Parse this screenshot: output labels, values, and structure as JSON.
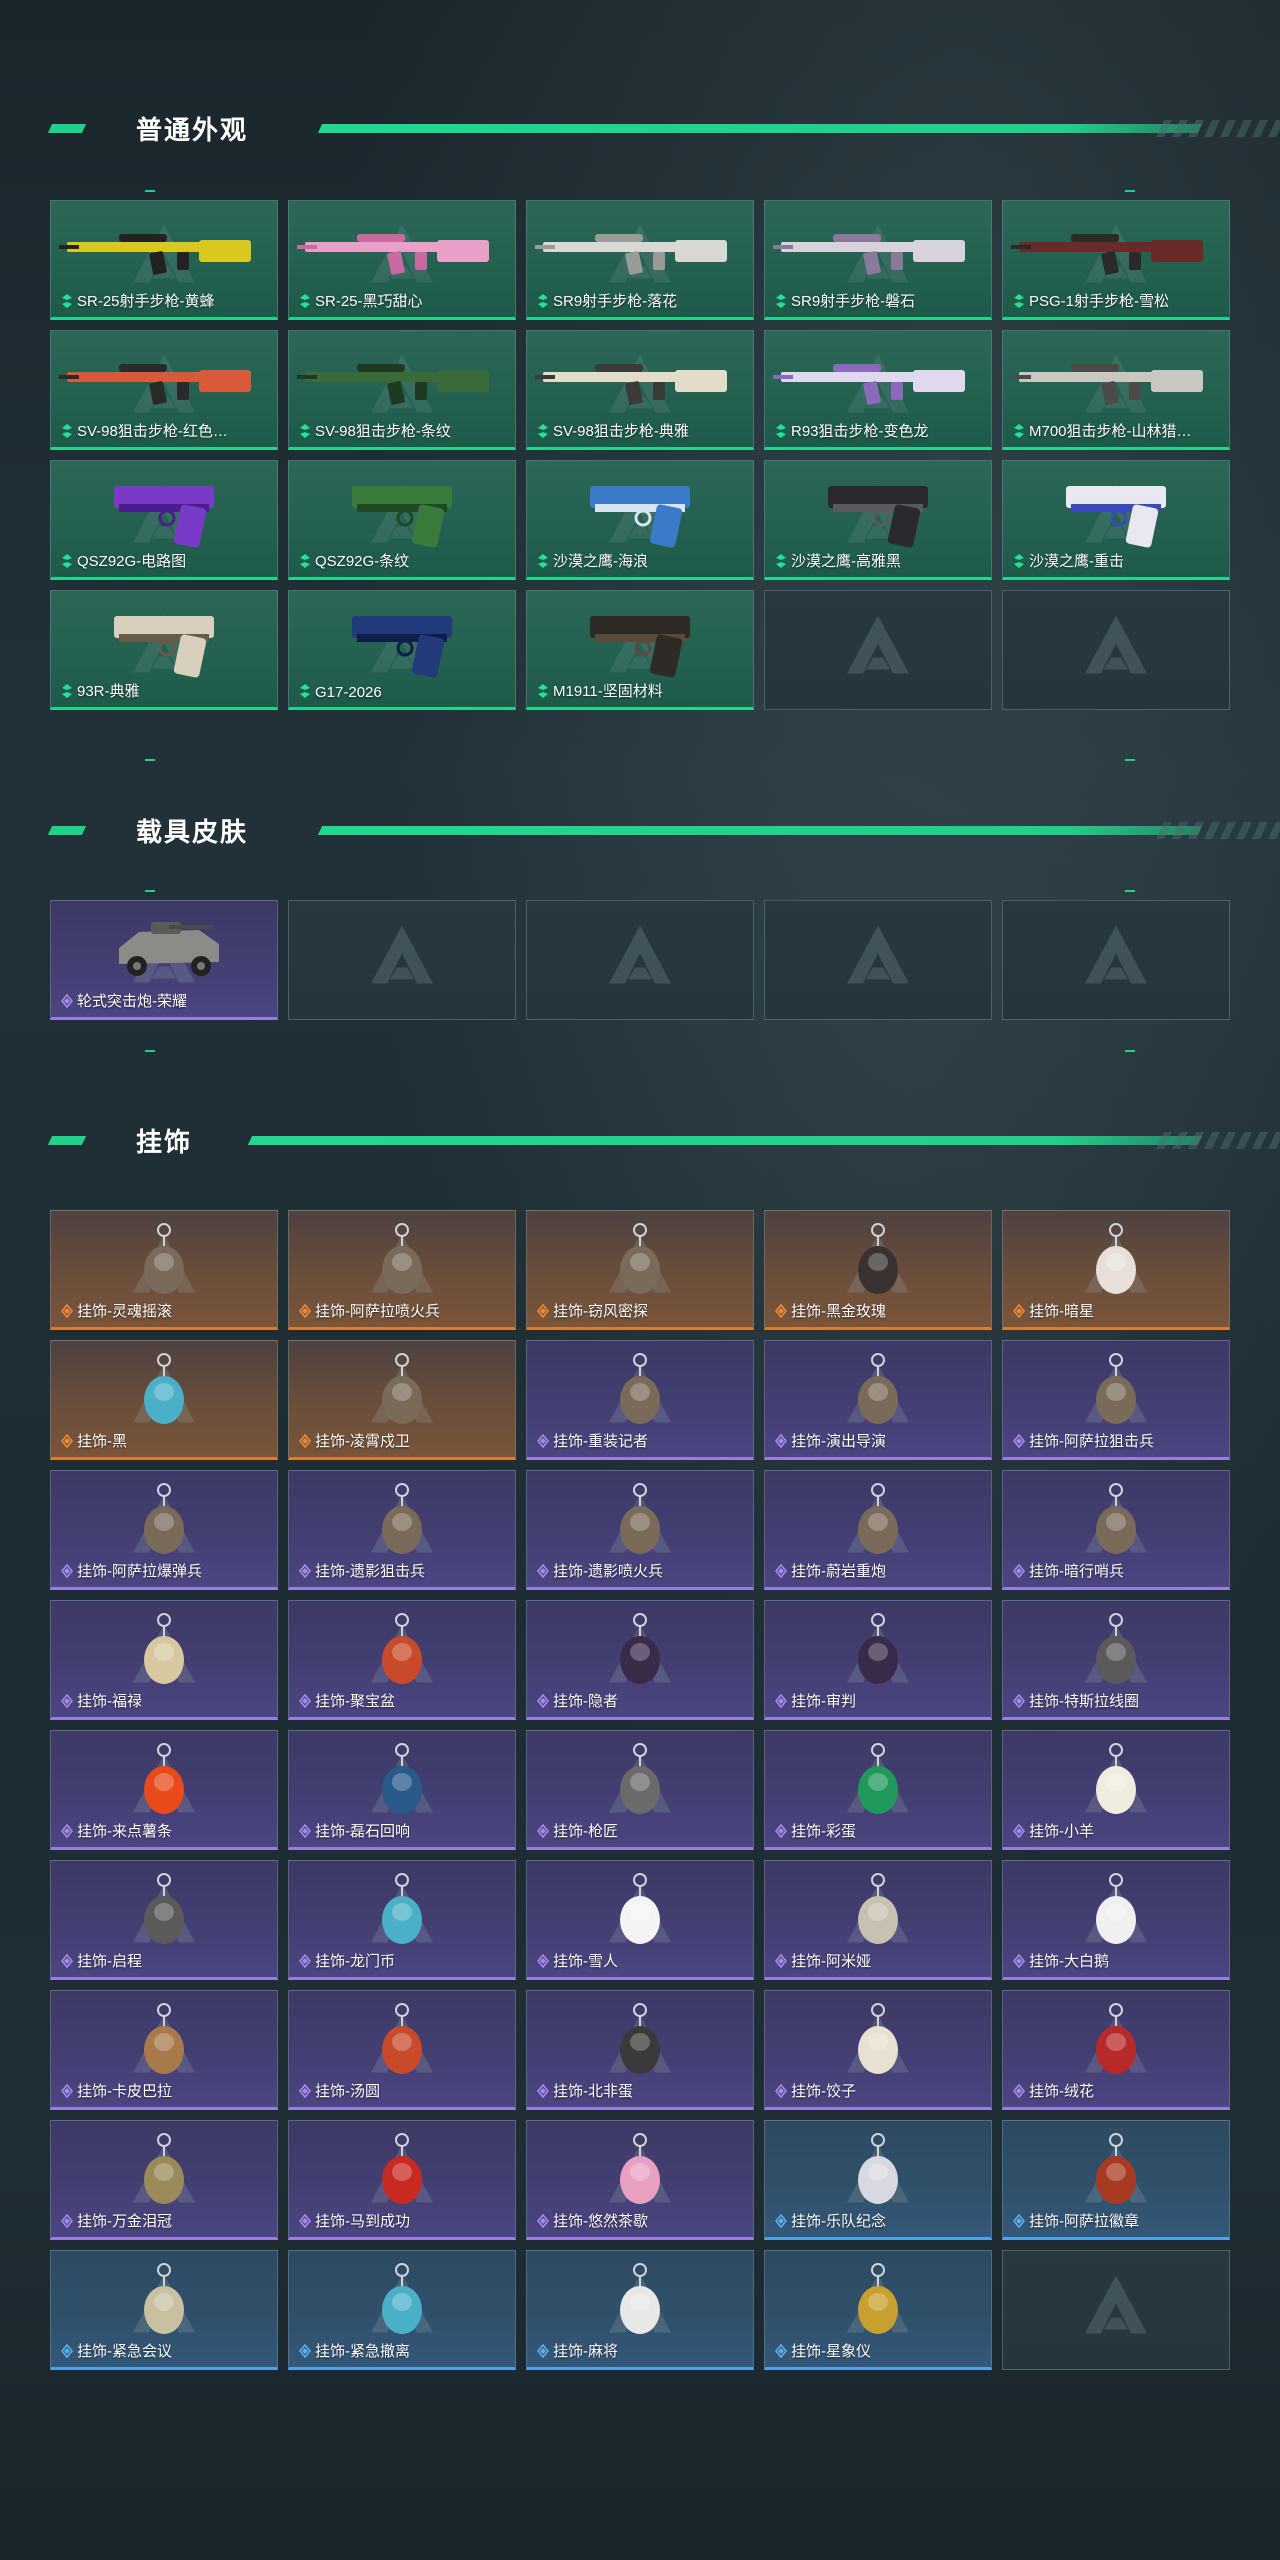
{
  "sections": [
    {
      "title": "普通外观",
      "items": [
        {
          "label": "SR-25射手步枪-黄蜂",
          "rarity": "green",
          "icon": "rifle-yellow-black-icon"
        },
        {
          "label": "SR-25-黑巧甜心",
          "rarity": "green",
          "icon": "rifle-pink-icon"
        },
        {
          "label": "SR9射手步枪-落花",
          "rarity": "green",
          "icon": "rifle-white-icon"
        },
        {
          "label": "SR9射手步枪-磐石",
          "rarity": "green",
          "icon": "rifle-marble-icon"
        },
        {
          "label": "PSG-1射手步枪-雪松",
          "rarity": "green",
          "icon": "rifle-dark-red-icon"
        },
        {
          "label": "SV-98狙击步枪-红色…",
          "rarity": "green",
          "icon": "sniper-red-icon"
        },
        {
          "label": "SV-98狙击步枪-条纹",
          "rarity": "green",
          "icon": "sniper-camo-icon"
        },
        {
          "label": "SV-98狙击步枪-典雅",
          "rarity": "green",
          "icon": "sniper-cream-icon"
        },
        {
          "label": "R93狙击步枪-变色龙",
          "rarity": "green",
          "icon": "sniper-purple-icon"
        },
        {
          "label": "M700狙击步枪-山林猎…",
          "rarity": "green",
          "icon": "sniper-grey-icon"
        },
        {
          "label": "QSZ92G-电路图",
          "rarity": "green",
          "icon": "pistol-purple-icon"
        },
        {
          "label": "QSZ92G-条纹",
          "rarity": "green",
          "icon": "pistol-green-icon"
        },
        {
          "label": "沙漠之鹰-海浪",
          "rarity": "green",
          "icon": "deagle-blue-icon"
        },
        {
          "label": "沙漠之鹰-高雅黑",
          "rarity": "green",
          "icon": "deagle-black-icon"
        },
        {
          "label": "沙漠之鹰-重击",
          "rarity": "green",
          "icon": "deagle-white-icon"
        },
        {
          "label": "93R-典雅",
          "rarity": "green",
          "icon": "pistol-cream-icon"
        },
        {
          "label": "G17-2026",
          "rarity": "green",
          "icon": "pistol-navy-icon"
        },
        {
          "label": "M1911-坚固材料",
          "rarity": "green",
          "icon": "pistol-dark-icon"
        },
        {
          "label": "",
          "rarity": "empty",
          "icon": "empty-slot-icon"
        },
        {
          "label": "",
          "rarity": "empty",
          "icon": "empty-slot-icon"
        }
      ]
    },
    {
      "title": "载具皮肤",
      "items": [
        {
          "label": "轮式突击炮-荣耀",
          "rarity": "purple",
          "icon": "vehicle-icon"
        },
        {
          "label": "",
          "rarity": "empty",
          "icon": "empty-slot-icon"
        },
        {
          "label": "",
          "rarity": "empty",
          "icon": "empty-slot-icon"
        },
        {
          "label": "",
          "rarity": "empty",
          "icon": "empty-slot-icon"
        },
        {
          "label": "",
          "rarity": "empty",
          "icon": "empty-slot-icon"
        }
      ]
    },
    {
      "title": "挂饰",
      "items": [
        {
          "label": "挂饰-灵魂摇滚",
          "rarity": "orange",
          "icon": "charm-figure-icon"
        },
        {
          "label": "挂饰-阿萨拉喷火兵",
          "rarity": "orange",
          "icon": "charm-figure-icon"
        },
        {
          "label": "挂饰-窃风密探",
          "rarity": "orange",
          "icon": "charm-figure-icon"
        },
        {
          "label": "挂饰-黑金玫瑰",
          "rarity": "orange",
          "icon": "charm-rose-icon"
        },
        {
          "label": "挂饰-暗星",
          "rarity": "orange",
          "icon": "charm-star-icon"
        },
        {
          "label": "挂饰-黑",
          "rarity": "orange",
          "icon": "charm-tag-icon"
        },
        {
          "label": "挂饰-凌霄戍卫",
          "rarity": "orange",
          "icon": "charm-figure-icon"
        },
        {
          "label": "挂饰-重装记者",
          "rarity": "purple",
          "icon": "charm-figure-icon"
        },
        {
          "label": "挂饰-演出导演",
          "rarity": "purple",
          "icon": "charm-figure-icon"
        },
        {
          "label": "挂饰-阿萨拉狙击兵",
          "rarity": "purple",
          "icon": "charm-figure-icon"
        },
        {
          "label": "挂饰-阿萨拉爆弹兵",
          "rarity": "purple",
          "icon": "charm-figure-icon"
        },
        {
          "label": "挂饰-遗影狙击兵",
          "rarity": "purple",
          "icon": "charm-figure-icon"
        },
        {
          "label": "挂饰-遗影喷火兵",
          "rarity": "purple",
          "icon": "charm-figure-icon"
        },
        {
          "label": "挂饰-蔚岩重炮",
          "rarity": "purple",
          "icon": "charm-figure-icon"
        },
        {
          "label": "挂饰-暗行哨兵",
          "rarity": "purple",
          "icon": "charm-figure-icon"
        },
        {
          "label": "挂饰-福禄",
          "rarity": "purple",
          "icon": "charm-gourd-icon"
        },
        {
          "label": "挂饰-聚宝盆",
          "rarity": "purple",
          "icon": "charm-bowl-icon"
        },
        {
          "label": "挂饰-隐者",
          "rarity": "purple",
          "icon": "charm-card-icon"
        },
        {
          "label": "挂饰-审判",
          "rarity": "purple",
          "icon": "charm-card-icon"
        },
        {
          "label": "挂饰-特斯拉线圈",
          "rarity": "purple",
          "icon": "charm-coil-icon"
        },
        {
          "label": "挂饰-来点薯条",
          "rarity": "purple",
          "icon": "charm-fries-icon"
        },
        {
          "label": "挂饰-磊石回响",
          "rarity": "purple",
          "icon": "charm-ring-icon"
        },
        {
          "label": "挂饰-枪匠",
          "rarity": "purple",
          "icon": "charm-box-icon"
        },
        {
          "label": "挂饰-彩蛋",
          "rarity": "purple",
          "icon": "charm-egg-icon"
        },
        {
          "label": "挂饰-小羊",
          "rarity": "purple",
          "icon": "charm-sheep-icon"
        },
        {
          "label": "挂饰-启程",
          "rarity": "purple",
          "icon": "charm-compass-icon"
        },
        {
          "label": "挂饰-龙门币",
          "rarity": "purple",
          "icon": "charm-tag-icon"
        },
        {
          "label": "挂饰-雪人",
          "rarity": "purple",
          "icon": "charm-snowman-icon"
        },
        {
          "label": "挂饰-阿米娅",
          "rarity": "purple",
          "icon": "charm-bunny-icon"
        },
        {
          "label": "挂饰-大白鹅",
          "rarity": "purple",
          "icon": "charm-goose-icon"
        },
        {
          "label": "挂饰-卡皮巴拉",
          "rarity": "purple",
          "icon": "charm-capybara-icon"
        },
        {
          "label": "挂饰-汤圆",
          "rarity": "purple",
          "icon": "charm-bowl-icon"
        },
        {
          "label": "挂饰-北非蛋",
          "rarity": "purple",
          "icon": "charm-pan-icon"
        },
        {
          "label": "挂饰-饺子",
          "rarity": "purple",
          "icon": "charm-plate-icon"
        },
        {
          "label": "挂饰-绒花",
          "rarity": "purple",
          "icon": "charm-flower-icon"
        },
        {
          "label": "挂饰-万金泪冠",
          "rarity": "purple",
          "icon": "charm-burger-icon"
        },
        {
          "label": "挂饰-马到成功",
          "rarity": "purple",
          "icon": "charm-horse-icon"
        },
        {
          "label": "挂饰-悠然茶歇",
          "rarity": "purple",
          "icon": "charm-cake-icon"
        },
        {
          "label": "挂饰-乐队纪念",
          "rarity": "blue",
          "icon": "charm-badge-icon"
        },
        {
          "label": "挂饰-阿萨拉徽章",
          "rarity": "blue",
          "icon": "charm-medal-icon"
        },
        {
          "label": "挂饰-紧急会议",
          "rarity": "blue",
          "icon": "charm-crest-icon"
        },
        {
          "label": "挂饰-紧急撤离",
          "rarity": "blue",
          "icon": "charm-tag-icon"
        },
        {
          "label": "挂饰-麻将",
          "rarity": "blue",
          "icon": "charm-tile-icon"
        },
        {
          "label": "挂饰-星象仪",
          "rarity": "blue",
          "icon": "charm-astrolabe-icon"
        },
        {
          "label": "",
          "rarity": "empty",
          "icon": "empty-slot-icon"
        }
      ]
    }
  ],
  "colors": {
    "accent": "#1fd28a",
    "green_card": "#246151",
    "purple_card": "#433f72",
    "orange_card": "#6a4e3b",
    "blue_card": "#30506a",
    "empty_card": "#26383e"
  }
}
